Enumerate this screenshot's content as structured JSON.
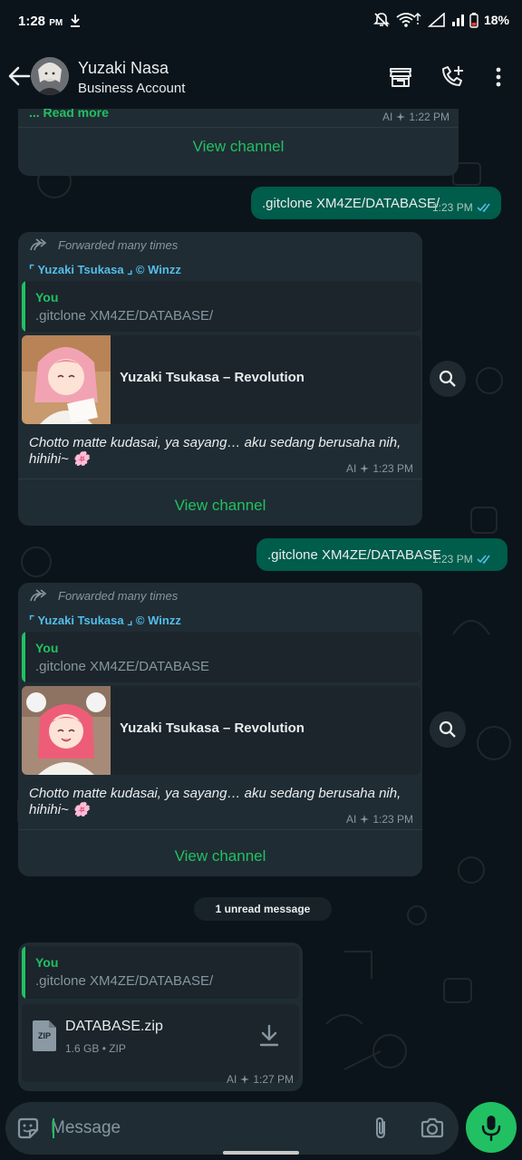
{
  "status_bar": {
    "time": "1:28",
    "ampm": "PM",
    "battery": "18%"
  },
  "header": {
    "contact_name": "Yuzaki Nasa",
    "contact_subtitle": "Business Account"
  },
  "messages": {
    "top_card": {
      "read_more": "... Read more",
      "meta_ai": "AI",
      "time": "1:22 PM",
      "view_channel": "View channel"
    },
    "out1": {
      "text": ".gitclone XM4ZE/DATABASE/",
      "time": "1:23 PM"
    },
    "in1": {
      "forwarded": "Forwarded many times",
      "channel": "⌜ Yuzaki Tsukasa ⌟ © Winzz",
      "quote_name": "You",
      "quote_text": ".gitclone XM4ZE/DATABASE/",
      "preview_title": "Yuzaki Tsukasa – Revolution",
      "caption": "Chotto matte kudasai, ya sayang… aku sedang berusaha nih, hihihi~ 🌸",
      "meta_ai": "AI",
      "time": "1:23 PM",
      "view_channel": "View channel"
    },
    "out2": {
      "text": ".gitclone XM4ZE/DATABASE",
      "time": "1:23 PM"
    },
    "in2": {
      "forwarded": "Forwarded many times",
      "channel": "⌜ Yuzaki Tsukasa ⌟ © Winzz",
      "quote_name": "You",
      "quote_text": ".gitclone XM4ZE/DATABASE",
      "preview_title": "Yuzaki Tsukasa – Revolution",
      "caption": "Chotto matte kudasai, ya sayang… aku sedang berusaha nih, hihihi~ 🌸",
      "meta_ai": "AI",
      "time": "1:23 PM",
      "view_channel": "View channel"
    },
    "unread": "1 unread message",
    "in3": {
      "quote_name": "You",
      "quote_text": ".gitclone XM4ZE/DATABASE/",
      "file_type_badge": "ZIP",
      "file_name": "DATABASE.zip",
      "file_meta": "1.6 GB • ZIP",
      "meta_ai": "AI",
      "time": "1:27 PM"
    }
  },
  "input": {
    "placeholder": "Message"
  },
  "colors": {
    "accent": "#21c063",
    "incoming_bubble": "#202c33",
    "outgoing_bubble": "#005c4b",
    "link_blue": "#53bdeb",
    "background": "#0b141a"
  }
}
